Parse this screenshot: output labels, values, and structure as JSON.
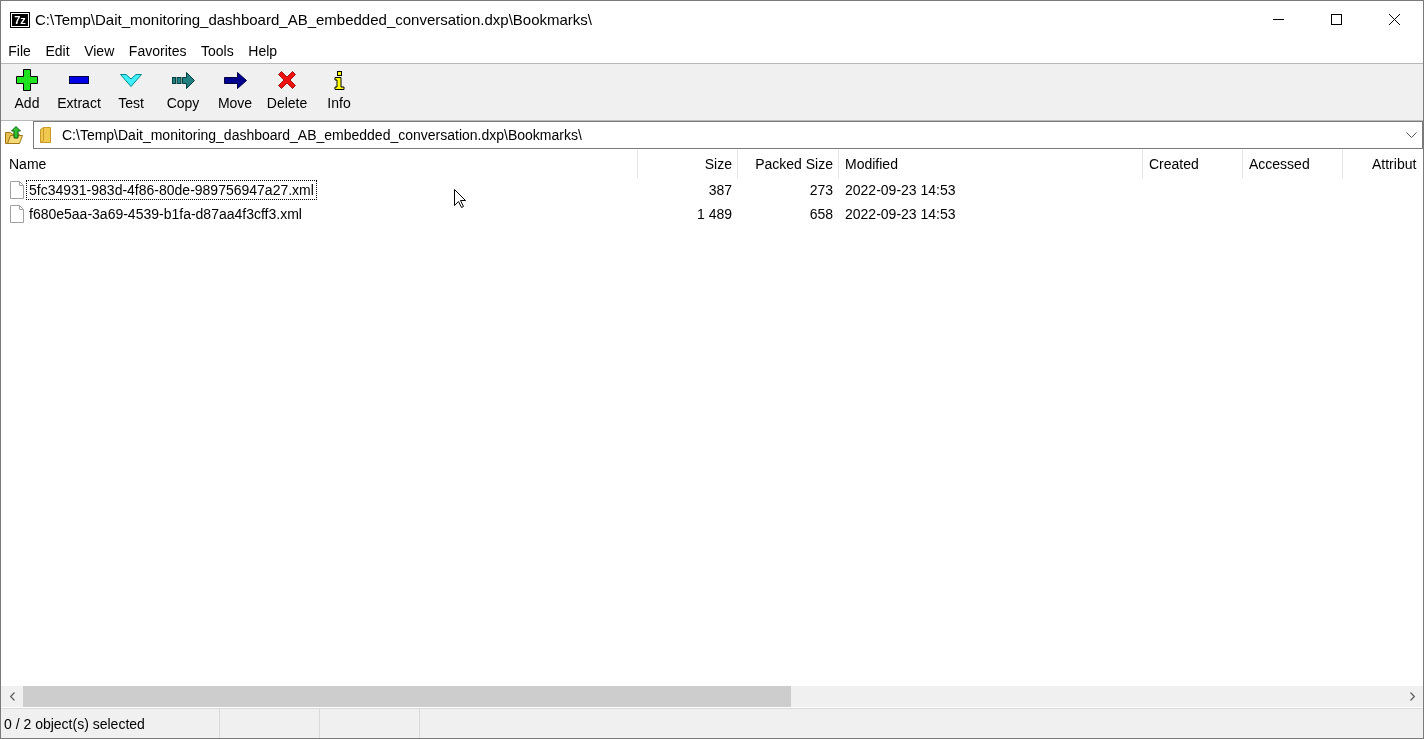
{
  "window": {
    "logo_text": "7z",
    "title": "C:\\Temp\\Dait_monitoring_dashboard_AB_embedded_conversation.dxp\\Bookmarks\\"
  },
  "menu": [
    "File",
    "Edit",
    "View",
    "Favorites",
    "Tools",
    "Help"
  ],
  "toolbar": [
    {
      "label": "Add",
      "kind": "add"
    },
    {
      "label": "Extract",
      "kind": "extract"
    },
    {
      "label": "Test",
      "kind": "test"
    },
    {
      "label": "Copy",
      "kind": "copy"
    },
    {
      "label": "Move",
      "kind": "move"
    },
    {
      "label": "Delete",
      "kind": "delete"
    },
    {
      "label": "Info",
      "kind": "info"
    }
  ],
  "address_bar": {
    "value": "C:\\Temp\\Dait_monitoring_dashboard_AB_embedded_conversation.dxp\\Bookmarks\\"
  },
  "table": {
    "columns": [
      {
        "label": "Name",
        "kind": "name"
      },
      {
        "label": "Size",
        "kind": "number"
      },
      {
        "label": "Packed Size",
        "kind": "number"
      },
      {
        "label": "Modified",
        "kind": "date"
      },
      {
        "label": "Created",
        "kind": "date"
      },
      {
        "label": "Accessed",
        "kind": "date"
      },
      {
        "label": "Attribut",
        "kind": "attributes"
      }
    ],
    "rows": [
      {
        "name": "5fc34931-983d-4f86-80de-989756947a27.xml",
        "size": "387",
        "packed_size": "273",
        "modified": "2022-09-23 14:53",
        "selected": false,
        "focused": true
      },
      {
        "name": "f680e5aa-3a69-4539-b1fa-d87aa4f3cff3.xml",
        "size": "1 489",
        "packed_size": "658",
        "modified": "2022-09-23 14:53",
        "selected": false,
        "focused": false
      }
    ]
  },
  "status_bar": {
    "text": "0 / 2 object(s) selected"
  }
}
